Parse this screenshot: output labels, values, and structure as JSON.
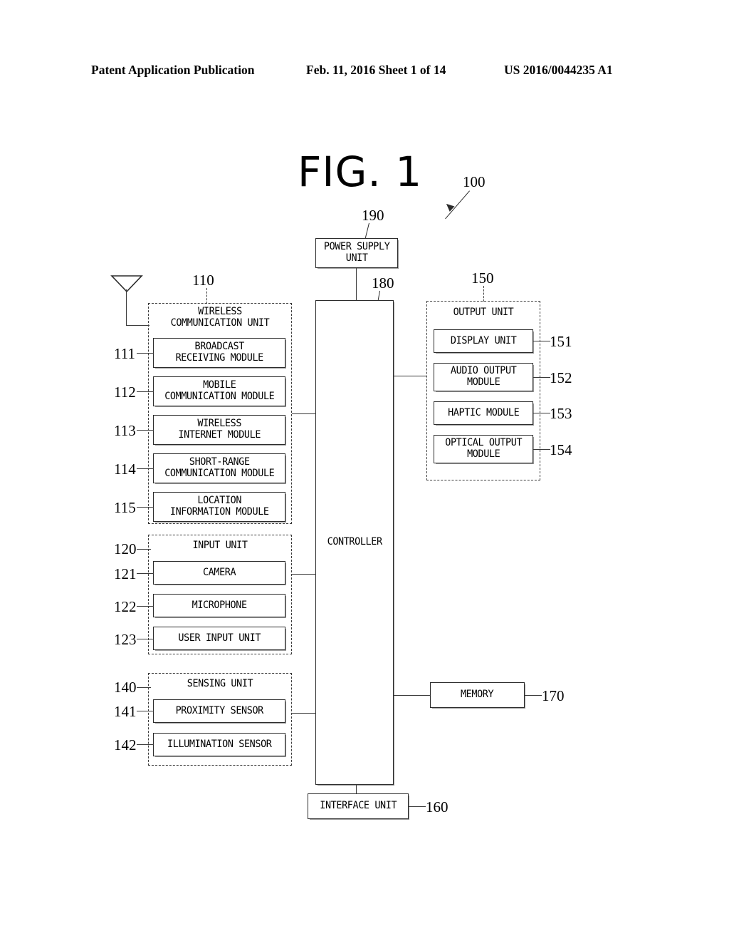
{
  "header": {
    "publication": "Patent Application Publication",
    "date_sheet": "Feb. 11, 2016  Sheet 1 of 14",
    "pub_number": "US 2016/0044235 A1"
  },
  "figure": {
    "title": "FIG. 1",
    "device_ref": "100"
  },
  "blocks": {
    "power_supply": {
      "label": "POWER SUPPLY\nUNIT",
      "ref": "190"
    },
    "controller": {
      "label": "CONTROLLER",
      "ref": "180"
    },
    "memory": {
      "label": "MEMORY",
      "ref": "170"
    },
    "interface": {
      "label": "INTERFACE UNIT",
      "ref": "160"
    }
  },
  "groups": {
    "wireless_communication_unit": {
      "title": "WIRELESS\nCOMMUNICATION UNIT",
      "ref": "110",
      "modules": [
        {
          "label": "BROADCAST\nRECEIVING MODULE",
          "ref": "111"
        },
        {
          "label": "MOBILE\nCOMMUNICATION MODULE",
          "ref": "112"
        },
        {
          "label": "WIRELESS\nINTERNET MODULE",
          "ref": "113"
        },
        {
          "label": "SHORT-RANGE\nCOMMUNICATION MODULE",
          "ref": "114"
        },
        {
          "label": "LOCATION\nINFORMATION MODULE",
          "ref": "115"
        }
      ]
    },
    "input_unit": {
      "title": "INPUT UNIT",
      "ref": "120",
      "modules": [
        {
          "label": "CAMERA",
          "ref": "121"
        },
        {
          "label": "MICROPHONE",
          "ref": "122"
        },
        {
          "label": "USER INPUT UNIT",
          "ref": "123"
        }
      ]
    },
    "sensing_unit": {
      "title": "SENSING UNIT",
      "ref": "140",
      "modules": [
        {
          "label": "PROXIMITY SENSOR",
          "ref": "141"
        },
        {
          "label": "ILLUMINATION SENSOR",
          "ref": "142"
        }
      ]
    },
    "output_unit": {
      "title": "OUTPUT UNIT",
      "ref": "150",
      "modules": [
        {
          "label": "DISPLAY UNIT",
          "ref": "151"
        },
        {
          "label": "AUDIO OUTPUT\nMODULE",
          "ref": "152"
        },
        {
          "label": "HAPTIC MODULE",
          "ref": "153"
        },
        {
          "label": "OPTICAL OUTPUT\nMODULE",
          "ref": "154"
        }
      ]
    }
  },
  "icons": {
    "antenna": "antenna-icon"
  }
}
